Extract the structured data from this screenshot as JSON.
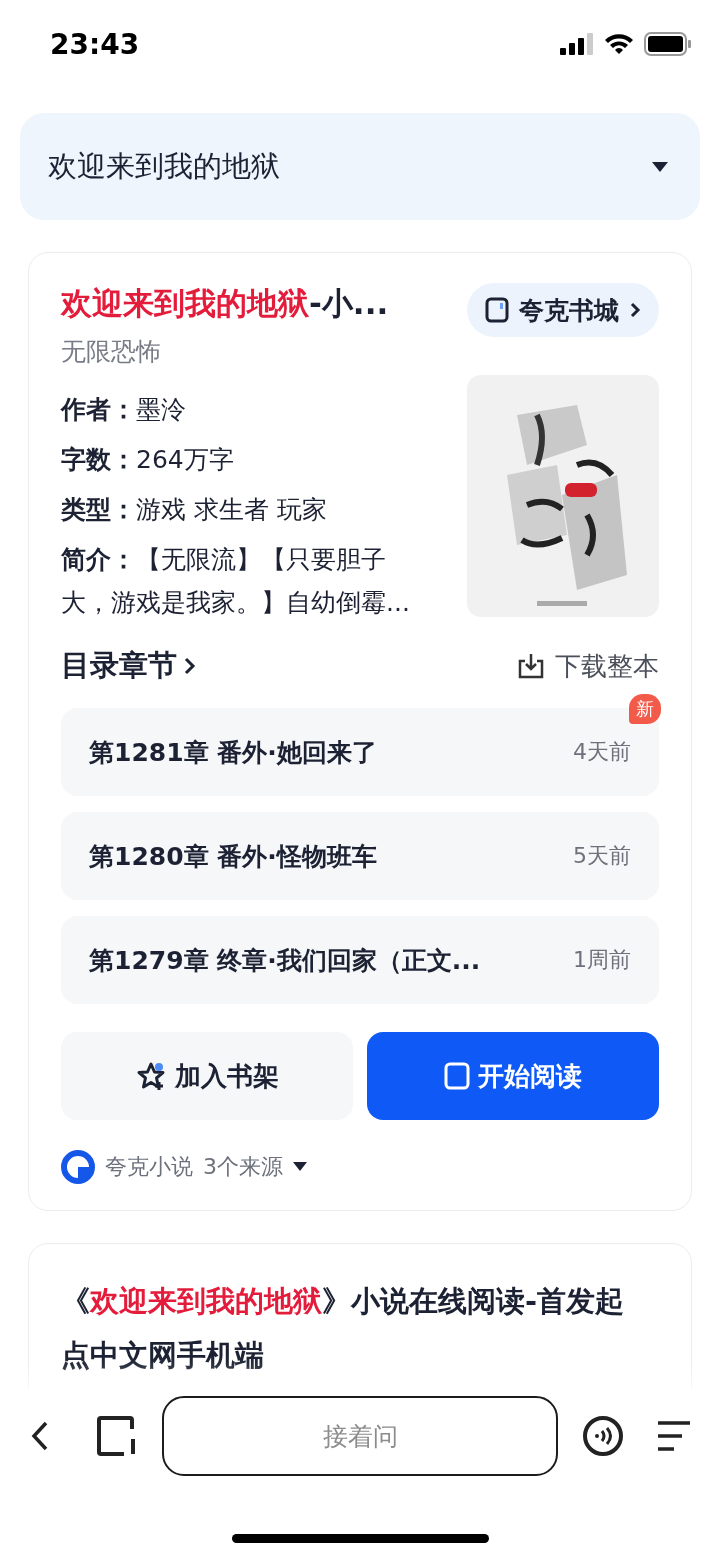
{
  "status_bar": {
    "time": "23:43"
  },
  "query": {
    "text": "欢迎来到我的地狱",
    "expanded": false
  },
  "book_card": {
    "title": [
      {
        "text": "欢迎来到我的地狱",
        "highlight": true
      },
      {
        "text": "-小...",
        "highlight": false
      }
    ],
    "category": "无限恐怖",
    "store_button": "夸克书城",
    "info": [
      {
        "label": "作者：",
        "value": "墨泠"
      },
      {
        "label": "字数：",
        "value": "264万字"
      },
      {
        "label": "类型：",
        "value": "游戏 求生者 玩家"
      },
      {
        "label": "简介：",
        "value": "【无限流】【只要胆子大，游戏是我家。】自幼倒霉..."
      }
    ],
    "toc_label": "目录章节",
    "download": "下载整本",
    "chapters": [
      {
        "title": "第1281章 番外·她回来了",
        "time": "4天前",
        "badge": "新"
      },
      {
        "title": "第1280章 番外·怪物班车",
        "time": "5天前"
      },
      {
        "title": "第1279章 终章·我们回家（正文...",
        "time": "1周前"
      }
    ],
    "shelf_button": "加入书架",
    "read_button": "开始阅读",
    "source": {
      "name": "夸克小说",
      "count": "3个来源"
    }
  },
  "result_card": {
    "title": [
      {
        "text": "《",
        "highlight": false
      },
      {
        "text": "欢迎来到我的地狱",
        "highlight": true
      },
      {
        "text": "》小说在线阅读-首发起点中文网手机端",
        "highlight": false
      }
    ]
  },
  "bottom_bar": {
    "placeholder": "接着问"
  }
}
